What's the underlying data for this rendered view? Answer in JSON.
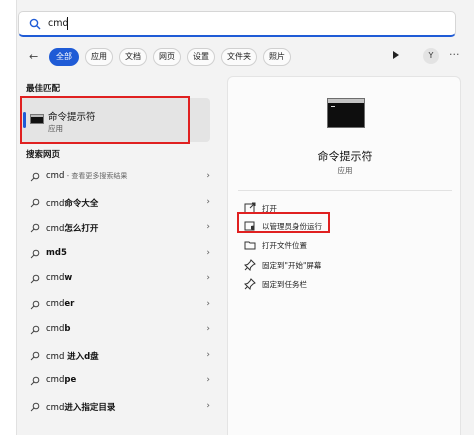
{
  "search": {
    "query": "cmd"
  },
  "filters": {
    "back": "←",
    "chips": [
      "全部",
      "应用",
      "文档",
      "网页",
      "设置",
      "文件夹",
      "照片"
    ],
    "avatar": "Y",
    "more": "···"
  },
  "best_match": {
    "heading": "最佳匹配",
    "title": "命令提示符",
    "subtitle": "应用"
  },
  "web_search": {
    "heading": "搜索网页",
    "items": [
      {
        "prefix": "cmd",
        "bold": "",
        "sub": " - 查看更多搜索结果"
      },
      {
        "prefix": "cmd",
        "bold": "命令大全",
        "sub": ""
      },
      {
        "prefix": "cmd",
        "bold": "怎么打开",
        "sub": ""
      },
      {
        "prefix": "",
        "bold": "md5",
        "sub": ""
      },
      {
        "prefix": "cmd",
        "bold": "w",
        "sub": ""
      },
      {
        "prefix": "cmd",
        "bold": "er",
        "sub": ""
      },
      {
        "prefix": "cmd",
        "bold": "b",
        "sub": ""
      },
      {
        "prefix": "cmd ",
        "bold": "进入d盘",
        "sub": ""
      },
      {
        "prefix": "cmd",
        "bold": "pe",
        "sub": ""
      },
      {
        "prefix": "cmd",
        "bold": "进入指定目录",
        "sub": ""
      }
    ]
  },
  "detail": {
    "title": "命令提示符",
    "subtitle": "应用",
    "actions": [
      {
        "label": "打开",
        "icon": "open-external-icon"
      },
      {
        "label": "以管理员身份运行",
        "icon": "shield-admin-icon"
      },
      {
        "label": "打开文件位置",
        "icon": "folder-icon"
      },
      {
        "label": "固定到\"开始\"屏幕",
        "icon": "pin-icon"
      },
      {
        "label": "固定到任务栏",
        "icon": "pin-icon"
      }
    ]
  },
  "colors": {
    "accent": "#1f5bd6",
    "highlight_box": "#e02020"
  }
}
